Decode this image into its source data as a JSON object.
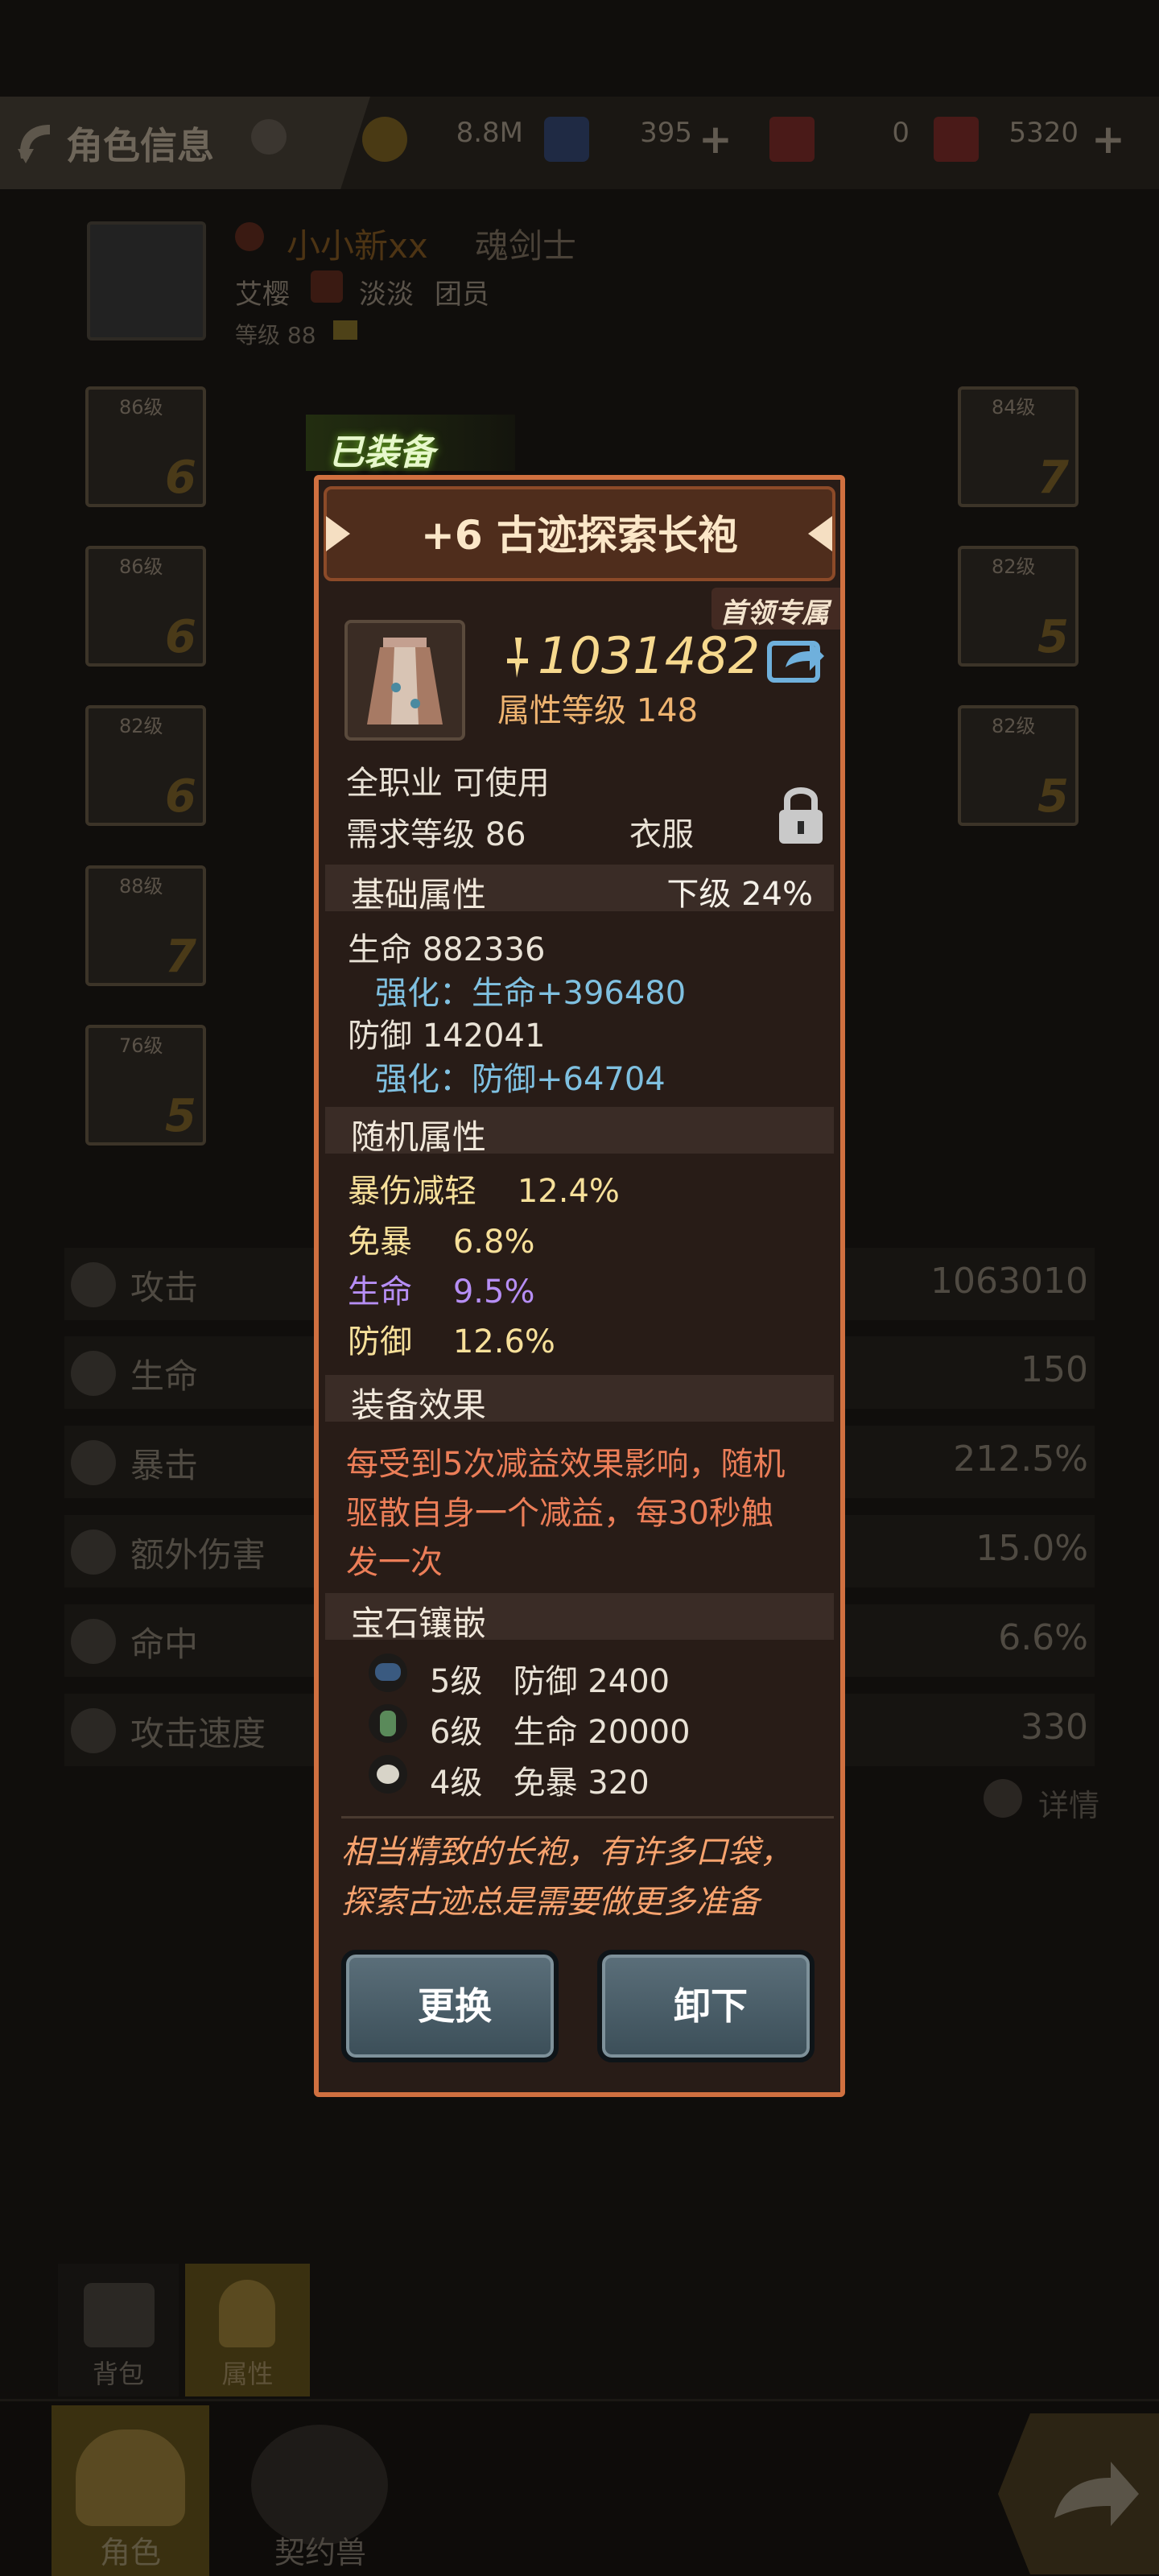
{
  "header": {
    "title": "角色信息",
    "gold": "8.8M",
    "gems": "395",
    "ticket_a": "0",
    "ticket_b": "5320"
  },
  "profile": {
    "name": "小小新xx",
    "class": "魂剑士",
    "server": "艾樱",
    "guild": "淡淡",
    "role": "团员",
    "level": "等级 88"
  },
  "left_slots": [
    {
      "level": "86级",
      "plus": "6"
    },
    {
      "level": "86级",
      "plus": "6"
    },
    {
      "level": "82级",
      "plus": "6"
    },
    {
      "level": "88级",
      "plus": "7"
    },
    {
      "level": "76级",
      "plus": "5"
    }
  ],
  "right_slots": [
    {
      "level": "84级",
      "plus": "7"
    },
    {
      "level": "82级",
      "plus": "5"
    },
    {
      "level": "82级",
      "plus": "5"
    }
  ],
  "stats": [
    {
      "label": "攻击",
      "value": "1063010"
    },
    {
      "label": "生命",
      "value": "150"
    },
    {
      "label": "暴击",
      "value": "212.5%"
    },
    {
      "label": "额外伤害",
      "value": "15.0%"
    },
    {
      "label": "命中",
      "value": "6.6%"
    },
    {
      "label": "攻击速度",
      "value": "330"
    }
  ],
  "details_link": "详情",
  "tabs": {
    "bag": "背包",
    "attributes": "属性",
    "character": "角色",
    "pet": "契约兽"
  },
  "item": {
    "equipped_badge": "已装备",
    "name": "+6 古迹探索长袍",
    "exclusive_tag": "首领专属",
    "power": "1031482",
    "attr_level": "属性等级 148",
    "usable": "全职业 可使用",
    "req_level": "需求等级 86",
    "slot_type": "衣服",
    "base_title": "基础属性",
    "base_grade": "下级  24%",
    "hp": "生命  882336",
    "hp_enh": "强化：生命+396480",
    "def": "防御  142041",
    "def_enh": "强化：防御+64704",
    "random_title": "随机属性",
    "rand1": "暴伤减轻    12.4%",
    "rand2": "免暴    6.8%",
    "rand3": "生命    9.5%",
    "rand4": "防御    12.6%",
    "effect_title": "装备效果",
    "effect_lines": [
      "每受到5次减益效果影响，随机",
      "驱散自身一个减益，每30秒触",
      "发一次"
    ],
    "gem_title": "宝石镶嵌",
    "gems": [
      "5级   防御 2400",
      "6级   生命 20000",
      "4级   免暴 320"
    ],
    "flavor_lines": [
      "相当精致的长袍，有许多口袋，",
      "探索古迹总是需要做更多准备"
    ],
    "btn_replace": "更换",
    "btn_unequip": "卸下"
  },
  "colors": {
    "frame": "#d07040",
    "panel": "#281c17",
    "gold_text": "#f7d98e",
    "enhance_blue": "#7fc0e0",
    "purple": "#b68ef4",
    "effect_red": "#ec7e58"
  }
}
